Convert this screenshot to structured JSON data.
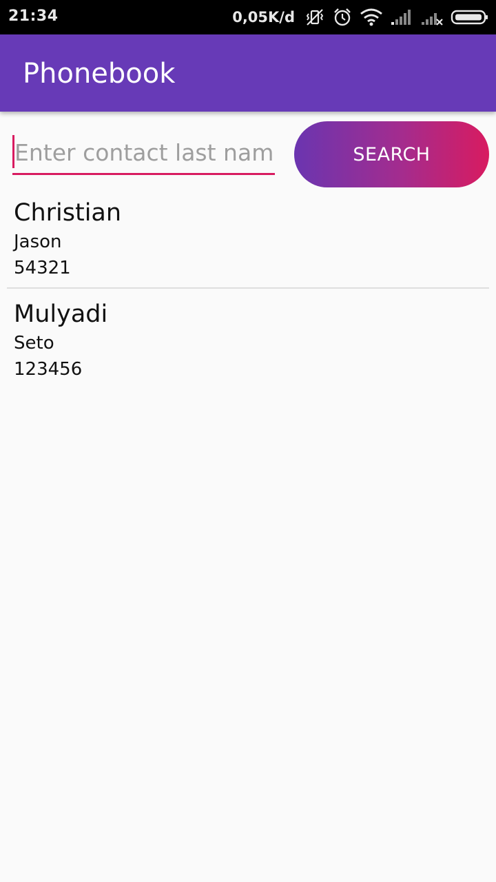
{
  "status_bar": {
    "time": "21:34",
    "net_speed": "0,05K/d",
    "icons": [
      "vibrate-off-icon",
      "alarm-icon",
      "wifi-icon",
      "signal-icon",
      "signal-no-service-icon",
      "battery-icon"
    ]
  },
  "app_bar": {
    "title": "Phonebook"
  },
  "search": {
    "placeholder": "Enter contact last name",
    "value": "",
    "button_label": "SEARCH"
  },
  "contacts": [
    {
      "last_name": "Christian",
      "first_name": "Jason",
      "phone": "54321"
    },
    {
      "last_name": "Mulyadi",
      "first_name": "Seto",
      "phone": "123456"
    }
  ],
  "colors": {
    "primary": "#673ab7",
    "accent": "#d81b60",
    "background": "#fafafa"
  }
}
